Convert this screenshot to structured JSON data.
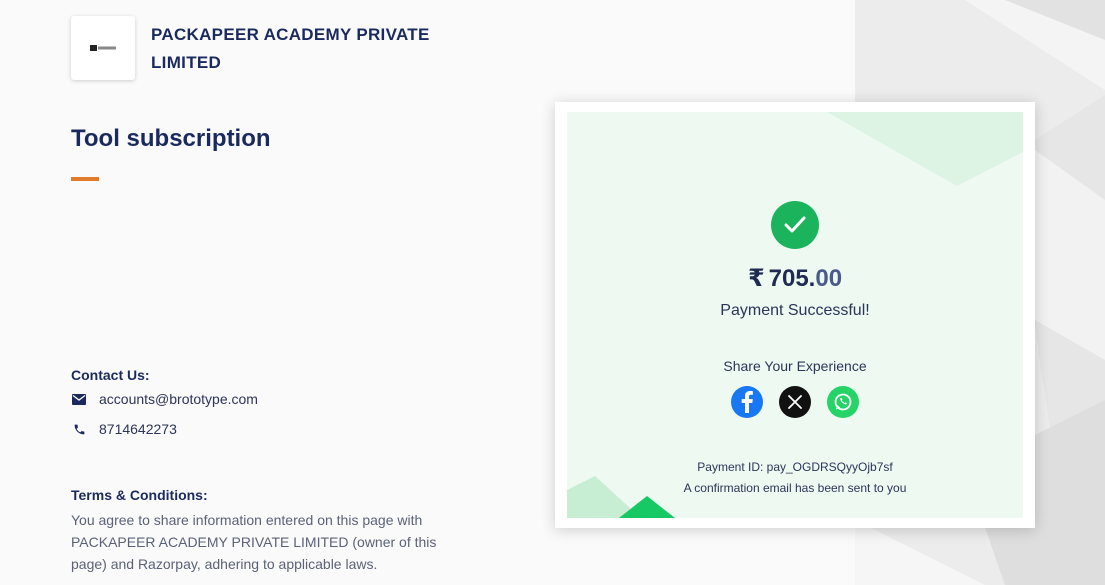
{
  "merchant": {
    "name": "PACKAPEER ACADEMY PRIVATE LIMITED",
    "logo_text": "BROTOTYPE"
  },
  "page": {
    "title": "Tool subscription"
  },
  "contact": {
    "heading": "Contact Us:",
    "email": "accounts@brototype.com",
    "phone": "8714642273",
    "email_icon": "mail-icon",
    "phone_icon": "phone-icon"
  },
  "terms": {
    "heading": "Terms & Conditions:",
    "text": "You agree to share information entered on this page with PACKAPEER ACADEMY PRIVATE LIMITED (owner of this page) and Razorpay, adhering to applicable laws."
  },
  "payment": {
    "currency_symbol": "₹",
    "amount_whole": "705.",
    "amount_decimal": "00",
    "status": "Payment Successful!",
    "share_heading": "Share Your Experience",
    "payment_id_text": "Payment ID: pay_OGDRSQyyOjb7sf",
    "confirmation_text": "A confirmation email has been sent to you",
    "share_icons": [
      "facebook-icon",
      "x-icon",
      "whatsapp-icon"
    ]
  },
  "colors": {
    "brand_navy": "#1b2a5e",
    "accent_orange": "#e07b2a",
    "success_green": "#1bb35c",
    "card_bg": "#edf9f1"
  }
}
